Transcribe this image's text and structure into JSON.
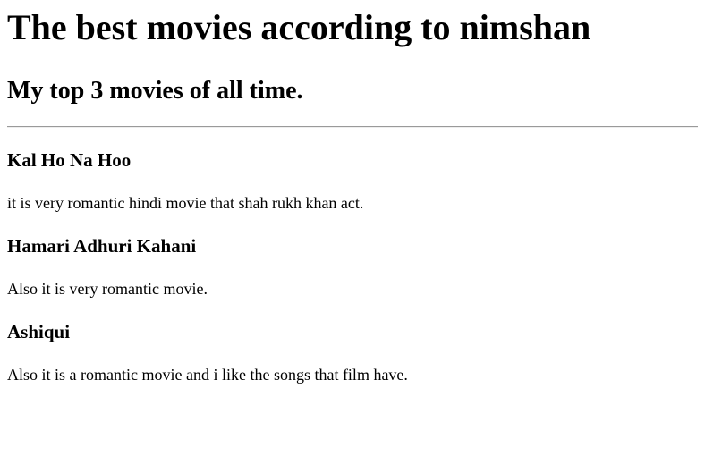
{
  "page": {
    "title": "The best movies according to nimshan",
    "subtitle": "My top 3 movies of all time."
  },
  "movies": [
    {
      "title": "Kal Ho Na Hoo",
      "description": "it is very romantic hindi movie that shah rukh khan act."
    },
    {
      "title": "Hamari Adhuri Kahani",
      "description": "Also it is very romantic movie."
    },
    {
      "title": "Ashiqui",
      "description": "Also it is a romantic movie and i like the songs that film have."
    }
  ]
}
